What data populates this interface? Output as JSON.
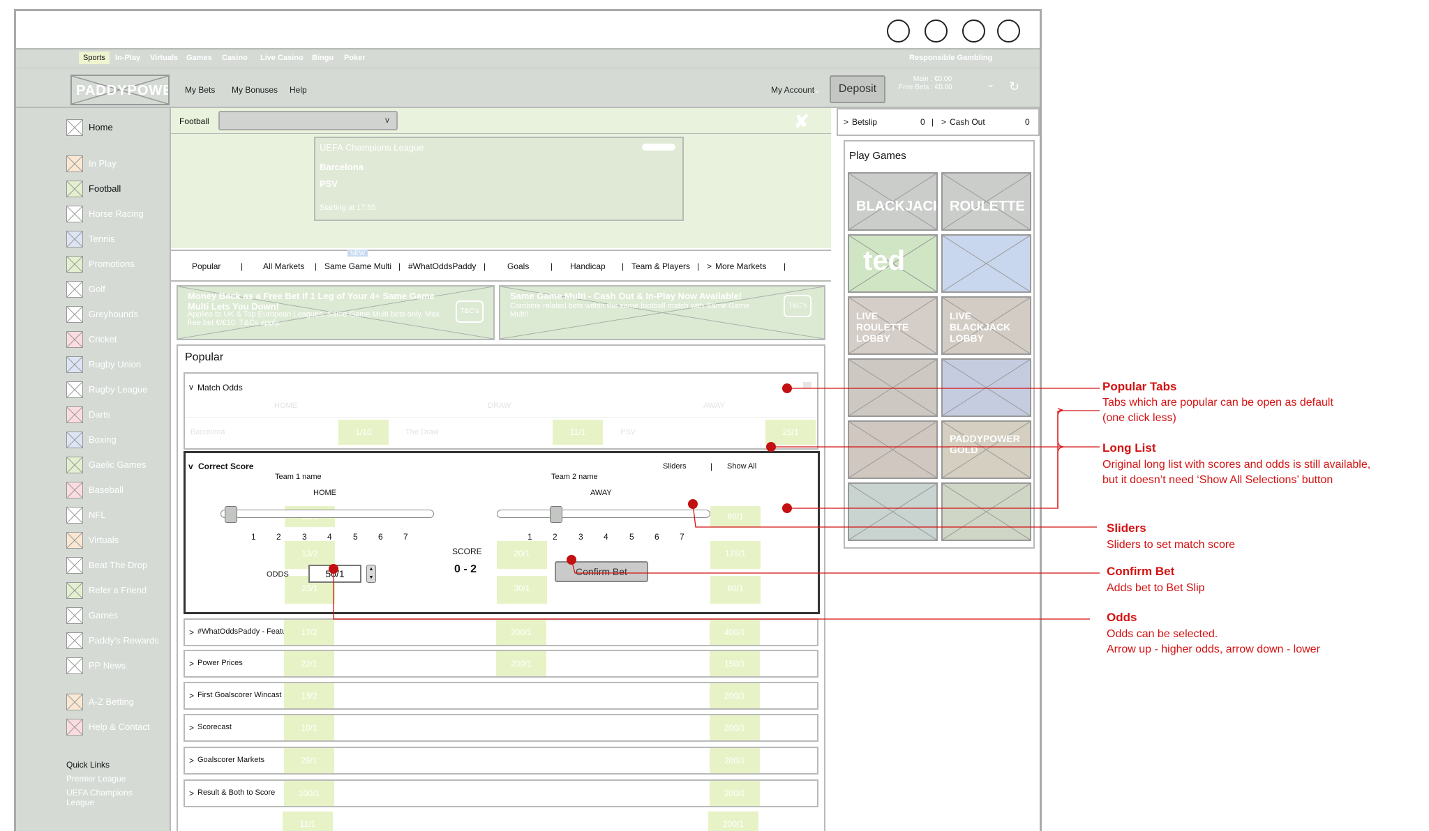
{
  "topnav": {
    "tabs": [
      "Sports",
      "In-Play",
      "Virtuals",
      "Games",
      "Casino",
      "Live Casino",
      "Bingo",
      "Poker"
    ],
    "responsible": "Responsible Gambling"
  },
  "header": {
    "logo": "PADDYPOWER",
    "links": [
      "My Bets",
      "My Bonuses",
      "Help"
    ],
    "account": "My Account",
    "deposit": "Deposit",
    "balance_main": "Main :  €0.00",
    "balance_free": "Free Bets :  €0.00"
  },
  "sidebar": {
    "items": [
      "Home",
      "In Play",
      "Football",
      "Horse Racing",
      "Tennis",
      "Promotions",
      "Golf",
      "Greyhounds",
      "Cricket",
      "Rugby Union",
      "Rugby League",
      "Darts",
      "Boxing",
      "Gaelic Games",
      "Baseball",
      "NFL",
      "Virtuals",
      "Beat The Drop",
      "Refer a Friend",
      "Games",
      "Paddy's Rewards",
      "PP News",
      "A-Z Betting",
      "Help & Contact"
    ],
    "quick_links_title": "Quick Links",
    "quick_links": [
      "Premier League",
      "UEFA Champions League"
    ]
  },
  "filter": {
    "sport": "Football",
    "select_value": "v"
  },
  "match": {
    "competition": "UEFA Champions League",
    "team1": "Barcelona",
    "team2": "PSV",
    "start": "Starting at 17:55"
  },
  "markets_tabs": [
    "Popular",
    "All Markets",
    "Same Game Multi",
    "#WhatOddsPaddy",
    "Goals",
    "Handicap",
    "Team & Players",
    "More Markets"
  ],
  "promos": [
    {
      "title": "Money Back as a Free Bet if 1 Leg of Your 4+ Same Game Multi Lets You Down!",
      "sub": "Applies to UK & Top European Leagues. Same Game Multi bets only. Max free bet €/£10. T&Cs apply.",
      "tc": "T&C's"
    },
    {
      "title": "Same Game Multi - Cash Out & In-Play Now Available!",
      "sub": "Combine related bets within the same football match with Same Game Multi!",
      "tc": "T&C's"
    }
  ],
  "popular": {
    "title": "Popular",
    "match_odds": {
      "title": "Match Odds",
      "headers": [
        "HOME",
        "DRAW",
        "AWAY"
      ],
      "selections": [
        {
          "name": "Barcelona",
          "price": "1/10"
        },
        {
          "name": "The Draw",
          "price": "11/1"
        },
        {
          "name": "PSV",
          "price": "25/1"
        }
      ]
    },
    "correct_score": {
      "title": "Correct Score",
      "sliders_label": "Sliders",
      "show_all": "Show All",
      "team1_label": "Team 1 name",
      "team1_side": "HOME",
      "team2_label": "Team 2 name",
      "team2_side": "AWAY",
      "ticks": [
        "1",
        "2",
        "3",
        "4",
        "5",
        "6",
        "7"
      ],
      "home_value": 0,
      "away_value": 2,
      "odds_label": "ODDS",
      "odds_value": "50/1",
      "score_label": "SCORE",
      "score": "0 - 2",
      "confirm": "Confirm Bet"
    },
    "collapsed": [
      "#WhatOddsPaddy - Featured",
      "Power Prices",
      "First Goalscorer Wincast",
      "Scorecast",
      "Goalscorer Markets",
      "Result & Both to Score"
    ]
  },
  "right": {
    "betslip": "Betslip",
    "betslip_count": "0",
    "cashout": "Cash Out",
    "cashout_count": "0",
    "games_title": "Play Games",
    "tiles": [
      "BLACKJACK",
      "ROULETTE",
      "ted",
      "",
      "LIVE ROULETTE LOBBY",
      "LIVE BLACKJACK LOBBY",
      "",
      "",
      "",
      "PADDYPOWER GOLD",
      "",
      ""
    ]
  },
  "annotations": [
    {
      "title": "Popular Tabs",
      "desc": [
        "Tabs which are popular can be open as default",
        "(one click less)"
      ]
    },
    {
      "title": "Long List",
      "desc": [
        "Original long list with scores and odds is still available,",
        "but it doesn’t need ‘Show All Selections’ button"
      ]
    },
    {
      "title": "Sliders",
      "desc": [
        "Sliders to set match score"
      ]
    },
    {
      "title": "Confirm Bet",
      "desc": [
        "Adds bet to Bet Slip"
      ]
    },
    {
      "title": "Odds",
      "desc": [
        "Odds can be selected.",
        "Arrow up - higher odds, arrow down - lower"
      ]
    }
  ],
  "colors": {
    "annotation": "#d41111",
    "accent_green": "#e8f2dc",
    "odds_fill": "#e7f3c6",
    "chrome_grey": "#d5dad5"
  }
}
